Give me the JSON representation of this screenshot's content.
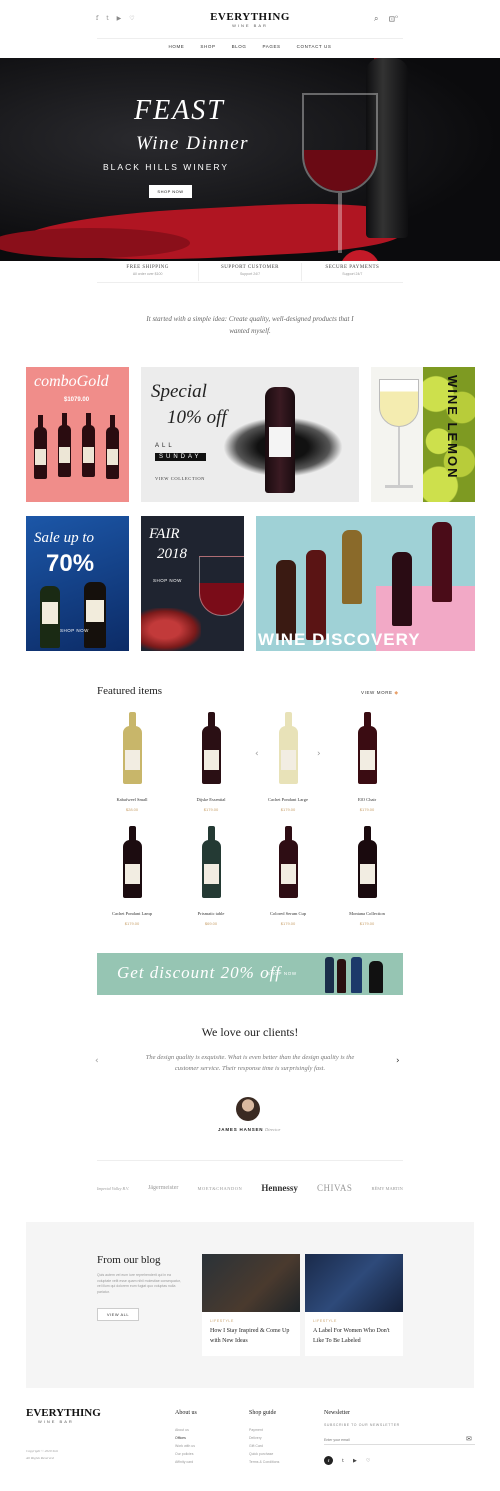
{
  "header": {
    "logo_title": "EVERYTHING",
    "logo_sub": "WINE BAR",
    "social": [
      "f",
      "t",
      "▶",
      "♡"
    ],
    "search_icon": "search-icon",
    "cart_icon": "cart-icon",
    "cart_count": "0"
  },
  "nav": [
    "HOME",
    "SHOP",
    "BLOG",
    "PAGES",
    "CONTACT US"
  ],
  "hero": {
    "title": "FEAST",
    "subtitle": "Wine Dinner",
    "tagline": "BLACK HILLS WINERY",
    "button": "SHOP NOW"
  },
  "features": [
    {
      "title": "FREE SHIPPING",
      "sub": "All order over $100"
    },
    {
      "title": "SUPPORT CUSTOMER",
      "sub": "Support 24/7"
    },
    {
      "title": "SECURE PAYMENTS",
      "sub": "Support 24/7"
    }
  ],
  "intro_quote": "It started with a simple idea: Create quality, well-designed products that I wanted myself.",
  "banners": {
    "combo_title": "comboGold",
    "combo_price": "$1079.00",
    "special_line1": "Special",
    "special_line2": "10% off",
    "special_all": "ALL",
    "special_day": "SUNDAY",
    "special_link": "VIEW COLLECTION",
    "lemon": "WINE LEMON",
    "sale_line": "Sale up to",
    "sale_pct": "70%",
    "sale_btn": "SHOP NOW",
    "fair_title": "FAIR",
    "fair_year": "2018",
    "fair_btn": "SHOP NOW",
    "discovery": "WINE DISCOVERY"
  },
  "featured": {
    "title": "Featured items",
    "view_more": "VIEW MORE",
    "products": [
      {
        "name": "Kabafweel Small",
        "price": "$28.00",
        "color": "#c8b66a"
      },
      {
        "name": "Dijske Essential",
        "price": "$179.00",
        "color": "#2a0f14"
      },
      {
        "name": "Cachet Pondant Large",
        "price": "$179.00",
        "color": "#e8e2b8"
      },
      {
        "name": "ElO Chair",
        "price": "$179.00",
        "color": "#3a0c12"
      },
      {
        "name": "Cachet Pondant Lamp",
        "price": "$179.00",
        "color": "#1c0c10"
      },
      {
        "name": "Prismatic table",
        "price": "$69.00",
        "color": "#243a34"
      },
      {
        "name": "Colored Serum Cup",
        "price": "$179.00",
        "color": "#2e0d14"
      },
      {
        "name": "Montana Collection",
        "price": "$179.00",
        "color": "#1a0a0e"
      }
    ]
  },
  "discount": {
    "text": "Get discount 20% off",
    "button": "SHOP NOW"
  },
  "testimonial": {
    "title": "We love our clients!",
    "quote": "The design quality is exquisite. What is even better than the design quality is the customer service. Their response time is surprisingly fast.",
    "name": "JAMES HANSEN",
    "role": "Director"
  },
  "brands": [
    "Imperial Valley B.V.",
    "Jägermeister",
    "MOET&CHANDON",
    "Hennessy",
    "CHIVAS",
    "RÉMY MARTIN"
  ],
  "blog": {
    "title": "From our blog",
    "text": "Quis autem vel eum iure reprehenderit qui in ea voluptate velit esse quam nihil molestiae consequatur, vel illum qui dolorem eum fugiat quo voluptas nulla pariatur.",
    "button": "VIEW ALL",
    "posts": [
      {
        "cat": "LIFESTYLE",
        "title": "How I Stay Inspired & Come Up with New Ideas"
      },
      {
        "cat": "LIFESTYLE",
        "title": "A Label For Women Who Don't Like To Be Labeled"
      }
    ]
  },
  "footer": {
    "logo_title": "EVERYTHING",
    "logo_sub": "WINE BAR",
    "copyright": "Copyright © 2020 Snit",
    "rights": "All Rights Reserved",
    "about_title": "About us",
    "about_links": [
      "About us",
      "Offices",
      "Work with us",
      "Our policies",
      "Affinity card"
    ],
    "guide_title": "Shop guide",
    "guide_links": [
      "Payment",
      "Delivery",
      "Gift Card",
      "Quick purchase",
      "Terms & Conditions"
    ],
    "newsletter_title": "Newsletter",
    "newsletter_sub": "SUBSCRIBE TO OUR NEWSLETTER",
    "newsletter_placeholder": "Enter your email"
  }
}
